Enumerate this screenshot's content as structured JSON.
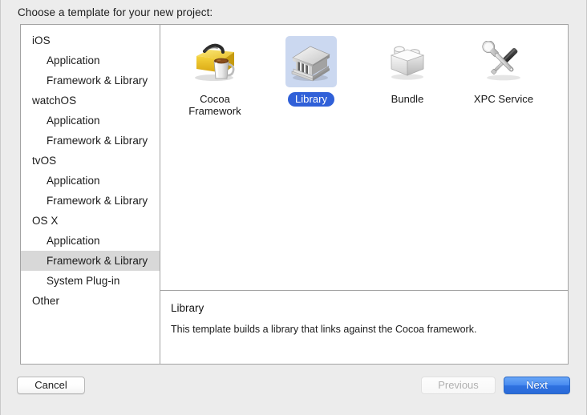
{
  "window": {
    "prompt": "Choose a template for your new project:"
  },
  "sidebar": {
    "items": [
      {
        "label": "iOS",
        "level": "group",
        "selected": false
      },
      {
        "label": "Application",
        "level": "child",
        "selected": false
      },
      {
        "label": "Framework & Library",
        "level": "child",
        "selected": false
      },
      {
        "label": "watchOS",
        "level": "group",
        "selected": false
      },
      {
        "label": "Application",
        "level": "child",
        "selected": false
      },
      {
        "label": "Framework & Library",
        "level": "child",
        "selected": false
      },
      {
        "label": "tvOS",
        "level": "group",
        "selected": false
      },
      {
        "label": "Application",
        "level": "child",
        "selected": false
      },
      {
        "label": "Framework & Library",
        "level": "child",
        "selected": false
      },
      {
        "label": "OS X",
        "level": "group",
        "selected": false
      },
      {
        "label": "Application",
        "level": "child",
        "selected": false
      },
      {
        "label": "Framework & Library",
        "level": "child",
        "selected": true
      },
      {
        "label": "System Plug-in",
        "level": "child",
        "selected": false
      },
      {
        "label": "Other",
        "level": "group",
        "selected": false
      }
    ]
  },
  "templates": [
    {
      "label": "Cocoa Framework",
      "icon": "toolbox-coffee-icon",
      "selected": false
    },
    {
      "label": "Library",
      "icon": "library-building-icon",
      "selected": true
    },
    {
      "label": "Bundle",
      "icon": "bundle-brick-icon",
      "selected": false
    },
    {
      "label": "XPC Service",
      "icon": "screwdriver-wrench-icon",
      "selected": false
    }
  ],
  "description": {
    "title": "Library",
    "body": "This template builds a library that links against the Cocoa framework."
  },
  "footer": {
    "cancel_label": "Cancel",
    "previous_label": "Previous",
    "next_label": "Next"
  },
  "colors": {
    "accent_blue": "#3060d8",
    "next_button_blue": "#2f72e0",
    "selection_gray": "#d8d8d8",
    "selection_tile_blue": "#cbd8f0"
  }
}
